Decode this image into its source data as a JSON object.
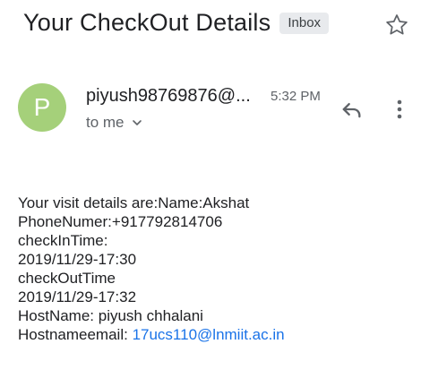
{
  "email": {
    "subject": "Your CheckOut Details",
    "label": "Inbox",
    "sender": "piyush98769876@...",
    "sender_initial": "P",
    "time": "5:32 PM",
    "recipient": "to me",
    "avatar_color": "#a5d07a"
  },
  "icons": {
    "star": "star-icon",
    "reply": "reply-icon",
    "more": "more-vertical-icon",
    "expand": "chevron-down-icon"
  },
  "body": {
    "lines": [
      "Your visit details are:Name:Akshat",
      "PhoneNumer:+917792814706",
      "checkInTime:",
      "2019/11/29-17:30",
      "checkOutTime",
      "2019/11/29-17:32",
      "HostName: piyush chhalani"
    ],
    "email_label": "Hostnameemail: ",
    "email_link": "17ucs110@lnmiit.ac.in"
  },
  "colors": {
    "link": "#1a73e8",
    "badge_bg": "#e8eaed"
  }
}
